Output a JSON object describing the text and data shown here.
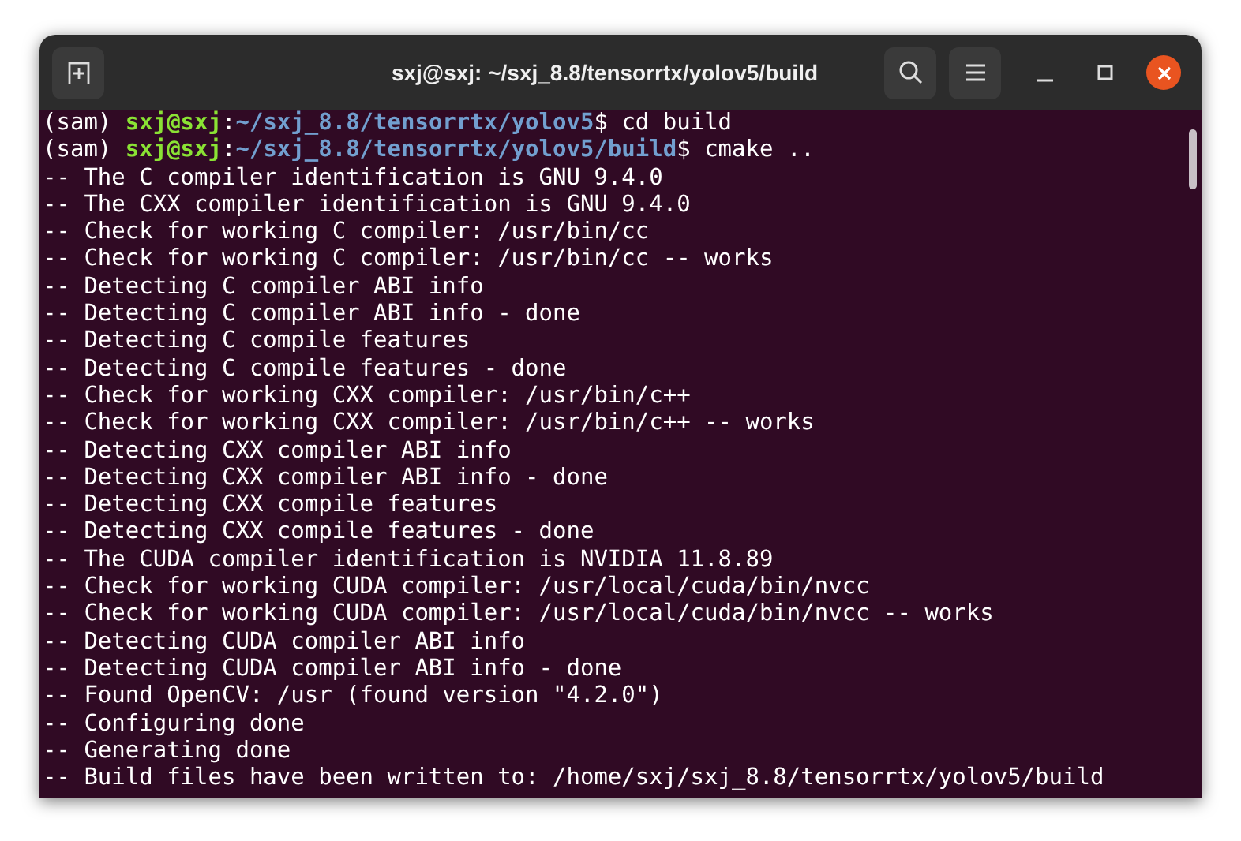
{
  "window": {
    "title": "sxj@sxj: ~/sxj_8.8/tensorrtx/yolov5/build"
  },
  "terminal": {
    "lines": [
      {
        "kind": "prompt",
        "env": "(sam) ",
        "user": "sxj@sxj",
        "sep": ":",
        "path": "~/sxj_8.8/tensorrtx/yolov5",
        "dollar": "$ ",
        "command": "cd build"
      },
      {
        "kind": "prompt",
        "env": "(sam) ",
        "user": "sxj@sxj",
        "sep": ":",
        "path": "~/sxj_8.8/tensorrtx/yolov5/build",
        "dollar": "$ ",
        "command": "cmake .."
      },
      {
        "kind": "output",
        "text": "-- The C compiler identification is GNU 9.4.0"
      },
      {
        "kind": "output",
        "text": "-- The CXX compiler identification is GNU 9.4.0"
      },
      {
        "kind": "output",
        "text": "-- Check for working C compiler: /usr/bin/cc"
      },
      {
        "kind": "output",
        "text": "-- Check for working C compiler: /usr/bin/cc -- works"
      },
      {
        "kind": "output",
        "text": "-- Detecting C compiler ABI info"
      },
      {
        "kind": "output",
        "text": "-- Detecting C compiler ABI info - done"
      },
      {
        "kind": "output",
        "text": "-- Detecting C compile features"
      },
      {
        "kind": "output",
        "text": "-- Detecting C compile features - done"
      },
      {
        "kind": "output",
        "text": "-- Check for working CXX compiler: /usr/bin/c++"
      },
      {
        "kind": "output",
        "text": "-- Check for working CXX compiler: /usr/bin/c++ -- works"
      },
      {
        "kind": "output",
        "text": "-- Detecting CXX compiler ABI info"
      },
      {
        "kind": "output",
        "text": "-- Detecting CXX compiler ABI info - done"
      },
      {
        "kind": "output",
        "text": "-- Detecting CXX compile features"
      },
      {
        "kind": "output",
        "text": "-- Detecting CXX compile features - done"
      },
      {
        "kind": "output",
        "text": "-- The CUDA compiler identification is NVIDIA 11.8.89"
      },
      {
        "kind": "output",
        "text": "-- Check for working CUDA compiler: /usr/local/cuda/bin/nvcc"
      },
      {
        "kind": "output",
        "text": "-- Check for working CUDA compiler: /usr/local/cuda/bin/nvcc -- works"
      },
      {
        "kind": "output",
        "text": "-- Detecting CUDA compiler ABI info"
      },
      {
        "kind": "output",
        "text": "-- Detecting CUDA compiler ABI info - done"
      },
      {
        "kind": "output",
        "text": "-- Found OpenCV: /usr (found version \"4.2.0\")"
      },
      {
        "kind": "output",
        "text": "-- Configuring done"
      },
      {
        "kind": "output",
        "text": "-- Generating done"
      },
      {
        "kind": "output",
        "text": "-- Build files have been written to: /home/sxj/sxj_8.8/tensorrtx/yolov5/build"
      }
    ]
  }
}
